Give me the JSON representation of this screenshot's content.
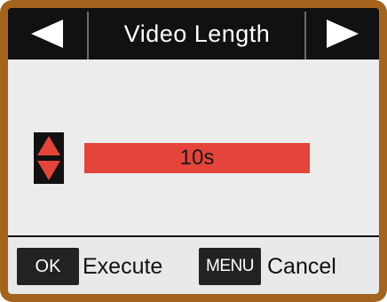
{
  "header": {
    "title": "Video Length",
    "prev_icon": "left-triangle-arrow",
    "next_icon": "right-triangle-arrow"
  },
  "setting": {
    "value": "10s",
    "adjust_icon": "up-down-arrows"
  },
  "footer": {
    "ok_key": "OK",
    "ok_action": "Execute",
    "menu_key": "MENU",
    "menu_action": "Cancel"
  },
  "colors": {
    "value_bar": "#e4443a",
    "bezel": "#a5641e",
    "bars": "#111111",
    "content_bg": "#ececec"
  }
}
